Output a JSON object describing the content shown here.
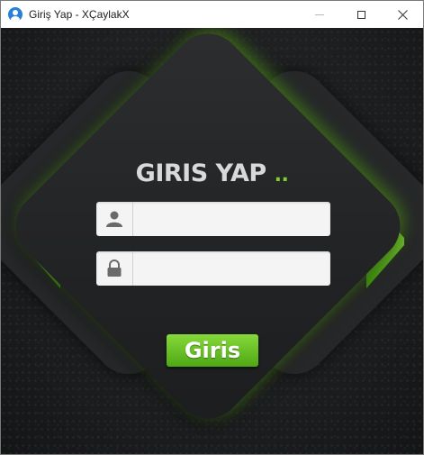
{
  "window": {
    "title": "Giriş Yap - XÇaylakX"
  },
  "form": {
    "heading": "GIRIS YAP",
    "heading_dots": "..",
    "username_value": "",
    "password_value": "",
    "login_button": "Giris"
  },
  "colors": {
    "accent_green": "#6cc423",
    "panel": "#2b2c2e",
    "background": "#1c1d1f"
  },
  "icons": {
    "app": "user-circle-icon",
    "username": "user-icon",
    "password": "lock-icon"
  }
}
